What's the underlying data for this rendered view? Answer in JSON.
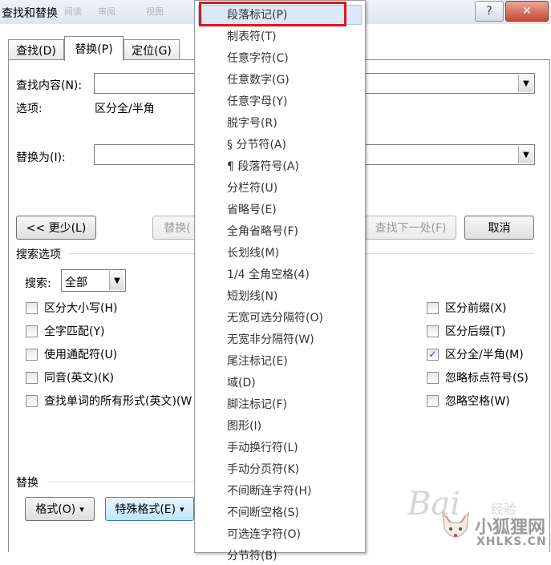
{
  "window": {
    "title": "查找和替换",
    "title_faded": [
      "阅读",
      "审阅",
      "视图"
    ],
    "help_glyph": "?",
    "close_glyph": "✕"
  },
  "tabs": [
    {
      "label": "查找(D)"
    },
    {
      "label": "替换(P)",
      "active": true
    },
    {
      "label": "定位(G)"
    }
  ],
  "find": {
    "label": "查找内容(N):",
    "value": ""
  },
  "options": {
    "label": "选项:",
    "value": "区分全/半角"
  },
  "replace_with": {
    "label": "替换为(I):",
    "value": ""
  },
  "buttons": {
    "less": "<< 更少(L)",
    "replace": "替换(",
    "find_next": "查找下一处(F)",
    "cancel": "取消"
  },
  "search_options": {
    "title": "搜索选项",
    "search_label": "搜索:",
    "search_value": "全部"
  },
  "checkboxes_left": [
    {
      "label": "区分大小写(H)",
      "checked": false
    },
    {
      "label": "全字匹配(Y)",
      "checked": false
    },
    {
      "label": "使用通配符(U)",
      "checked": false
    },
    {
      "label": "同音(英文)(K)",
      "checked": false
    },
    {
      "label": "查找单词的所有形式(英文)(W",
      "checked": false
    }
  ],
  "checkboxes_right": [
    {
      "label": "区分前缀(X)",
      "checked": false
    },
    {
      "label": "区分后缀(T)",
      "checked": false
    },
    {
      "label": "区分全/半角(M)",
      "checked": true
    },
    {
      "label": "忽略标点符号(S)",
      "checked": false
    },
    {
      "label": "忽略空格(W)",
      "checked": false
    }
  ],
  "replace_section": {
    "title": "替换",
    "format_button": "格式(O)",
    "special_button": "特殊格式(E)",
    "arrow_glyph": "▾"
  },
  "special_menu": {
    "items": [
      "段落标记(P)",
      "制表符(T)",
      "任意字符(C)",
      "任意数字(G)",
      "任意字母(Y)",
      "脱字号(R)",
      "§ 分节符(A)",
      "¶ 段落符号(A)",
      "分栏符(U)",
      "省略号(E)",
      "全角省略号(F)",
      "长划线(M)",
      "1/4 全角空格(4)",
      "短划线(N)",
      "无宽可选分隔符(O)",
      "无宽非分隔符(W)",
      "尾注标记(E)",
      "域(D)",
      "脚注标记(F)",
      "图形(I)",
      "手动换行符(L)",
      "手动分页符(K)",
      "不间断连字符(H)",
      "不间断空格(S)",
      "可选连字符(O)",
      "分节符(B)"
    ],
    "highlighted_index": 0
  },
  "watermark": {
    "baidu": "Bai",
    "baidu_tail": "经验",
    "site_name": "小狐狸网",
    "site_url": "XHLKS.CN"
  },
  "colors": {
    "highlight_border": "#e0151d",
    "menu_hover": "#dce8f7"
  }
}
